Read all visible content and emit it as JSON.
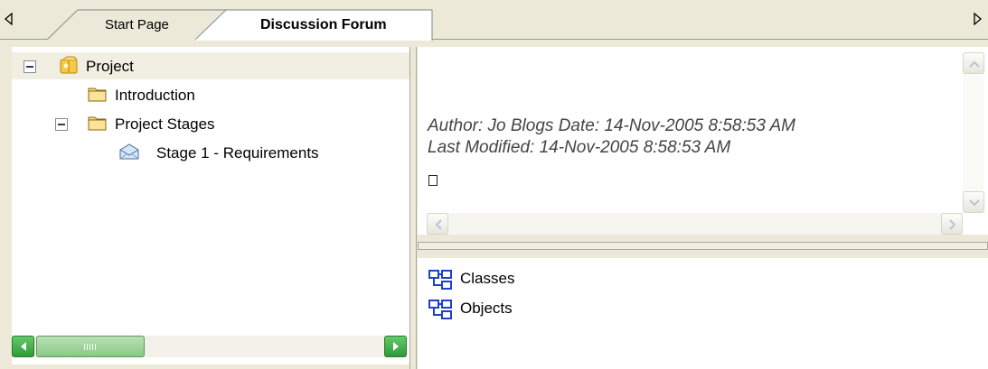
{
  "tabs": [
    {
      "label": "Start Page",
      "active": false
    },
    {
      "label": "Discussion Forum",
      "active": true
    }
  ],
  "tree": {
    "items": [
      {
        "label": "Project",
        "icon": "package-icon",
        "expanded": true,
        "selected": true
      },
      {
        "label": "Introduction",
        "icon": "folder-icon"
      },
      {
        "label": "Project Stages",
        "icon": "folder-icon",
        "expanded": true
      },
      {
        "label": "Stage 1 - Requirements",
        "icon": "diagram-envelope-icon"
      }
    ]
  },
  "notes": {
    "line1": "Author: Jo Blogs  Date: 14-Nov-2005 8:58:53 AM",
    "line2": "Last Modified: 14-Nov-2005 8:58:53 AM"
  },
  "list": {
    "items": [
      {
        "label": "Classes",
        "icon": "class-diagram-icon"
      },
      {
        "label": "Objects",
        "icon": "class-diagram-icon"
      }
    ]
  },
  "colors": {
    "background": "#ece9d8",
    "scrollbar_green": "#3fae4a",
    "tab_border": "#919b9c"
  }
}
